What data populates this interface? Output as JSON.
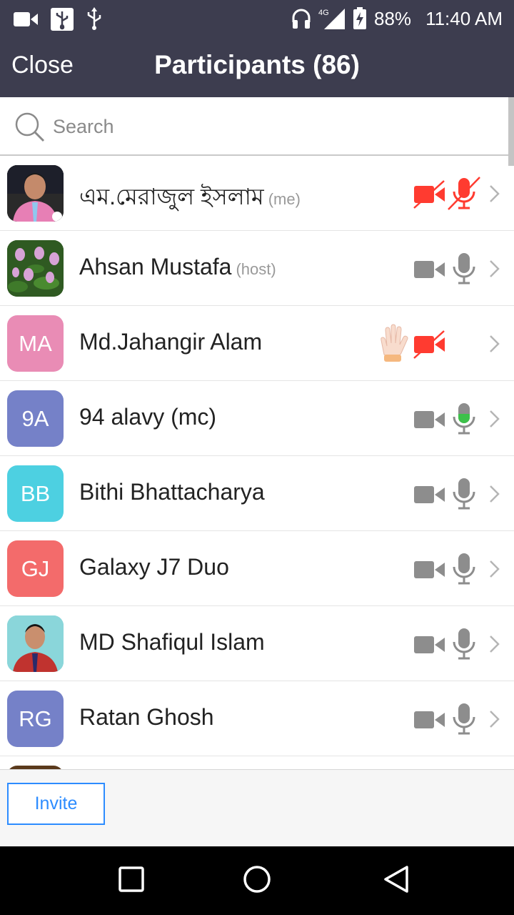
{
  "status_bar": {
    "battery": "88%",
    "time": "11:40 AM",
    "network": "4G"
  },
  "header": {
    "close_label": "Close",
    "title": "Participants (86)"
  },
  "search": {
    "placeholder": "Search"
  },
  "participants": [
    {
      "name": "এম.মেরাজুল ইসলাম",
      "tag": "(me)",
      "avatar_initials": "",
      "avatar_type": "photo-man-pink",
      "video": "off",
      "mic": "muted",
      "hand_raised": false
    },
    {
      "name": "Ahsan Mustafa",
      "tag": "(host)",
      "avatar_initials": "",
      "avatar_type": "photo-flowers",
      "video": "on",
      "mic": "on",
      "hand_raised": false
    },
    {
      "name": "Md.Jahangir Alam",
      "tag": "",
      "avatar_initials": "MA",
      "avatar_color": "#e98cb5",
      "video": "off",
      "mic": "none",
      "hand_raised": true
    },
    {
      "name": "94 alavy (mc)",
      "tag": "",
      "avatar_initials": "9A",
      "avatar_color": "#7581c8",
      "video": "on",
      "mic": "speaking",
      "hand_raised": false
    },
    {
      "name": "Bithi Bhattacharya",
      "tag": "",
      "avatar_initials": "BB",
      "avatar_color": "#4dd0e1",
      "video": "on",
      "mic": "on",
      "hand_raised": false
    },
    {
      "name": "Galaxy J7 Duo",
      "tag": "",
      "avatar_initials": "GJ",
      "avatar_color": "#f36b6b",
      "video": "on",
      "mic": "on",
      "hand_raised": false
    },
    {
      "name": "MD Shafiqul Islam",
      "tag": "",
      "avatar_initials": "",
      "avatar_type": "photo-man-red",
      "video": "on",
      "mic": "on",
      "hand_raised": false
    },
    {
      "name": "Ratan Ghosh",
      "tag": "",
      "avatar_initials": "RG",
      "avatar_color": "#7581c8",
      "video": "on",
      "mic": "on",
      "hand_raised": false
    }
  ],
  "footer": {
    "invite_label": "Invite"
  },
  "colors": {
    "header_bg": "#3d3d4f",
    "muted_red": "#ff3b30",
    "icon_gray": "#8d8d8d",
    "speaking_green": "#3dc14a",
    "accent_blue": "#2d8cff"
  },
  "icons": {
    "status": [
      "video-camera-icon",
      "usb-icon",
      "usb-tether-icon",
      "headphones-icon",
      "signal-icon",
      "battery-charging-icon"
    ],
    "nav": [
      "recent-apps-icon",
      "home-icon",
      "back-icon"
    ]
  }
}
